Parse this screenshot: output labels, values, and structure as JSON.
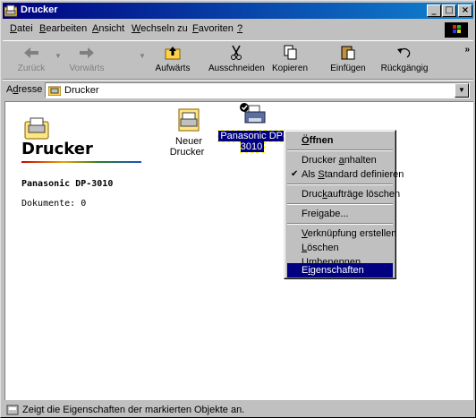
{
  "window": {
    "title": "Drucker"
  },
  "menubar": [
    {
      "pre": "",
      "acc": "D",
      "post": "atei"
    },
    {
      "pre": "",
      "acc": "B",
      "post": "earbeiten"
    },
    {
      "pre": "",
      "acc": "A",
      "post": "nsicht"
    },
    {
      "pre": "",
      "acc": "W",
      "post": "echseln zu"
    },
    {
      "pre": "",
      "acc": "F",
      "post": "avoriten"
    },
    {
      "pre": "",
      "acc": "?",
      "post": ""
    }
  ],
  "toolbar": {
    "back": "Zurück",
    "forward": "Vorwärts",
    "up": "Aufwärts",
    "cut": "Ausschneiden",
    "copy": "Kopieren",
    "paste": "Einfügen",
    "undo": "Rückgängig",
    "more": "»"
  },
  "address": {
    "label_pre": "A",
    "label_acc": "d",
    "label_post": "resse",
    "value": "Drucker"
  },
  "sidebar": {
    "title": "Drucker",
    "selected_printer": "Panasonic DP-3010",
    "documents": "Dokumente: 0"
  },
  "items": [
    {
      "label": "Neuer Drucker"
    },
    {
      "label": "Panasonic DP-3010"
    }
  ],
  "context_menu": [
    {
      "pre": "",
      "acc": "Ö",
      "post": "ffnen"
    },
    {
      "pre": "Drucker ",
      "acc": "a",
      "post": "nhalten"
    },
    {
      "pre": "Als ",
      "acc": "S",
      "post": "tandard definieren"
    },
    {
      "pre": "Druc",
      "acc": "k",
      "post": "aufträge löschen"
    },
    {
      "pre": "Freigabe...",
      "acc": "",
      "post": ""
    },
    {
      "pre": "",
      "acc": "V",
      "post": "erknüpfung erstellen"
    },
    {
      "pre": "",
      "acc": "L",
      "post": "öschen"
    },
    {
      "pre": "",
      "acc": "U",
      "post": "mbenennen"
    },
    {
      "pre": "E",
      "acc": "i",
      "post": "genschaften"
    }
  ],
  "status": {
    "text": "Zeigt die Eigenschaften der markierten Objekte an."
  },
  "colors": {
    "titlebar": "#000080",
    "highlight": "#000080",
    "desktop": "#008080"
  }
}
